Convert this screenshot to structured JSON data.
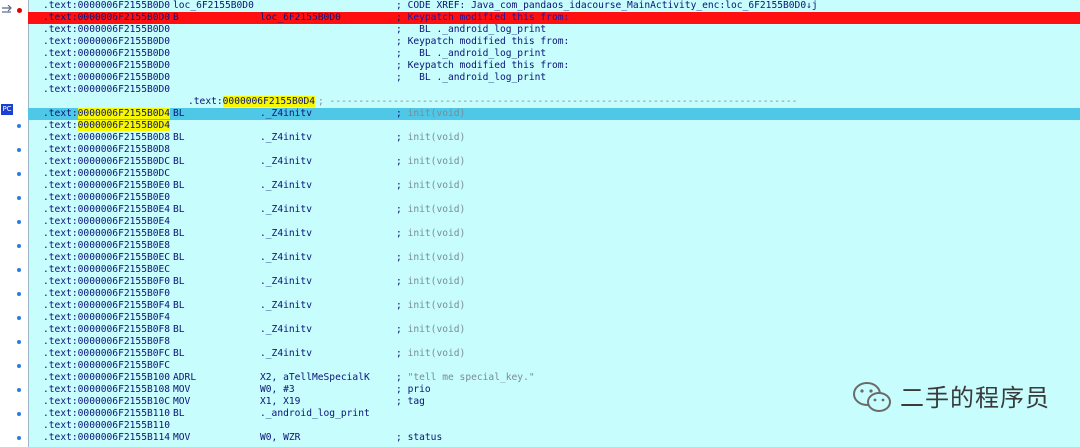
{
  "gutter": {
    "pc_label": "PC"
  },
  "rows": [
    {
      "addr": "text:0000006F2155B0D0",
      "addr_hl": "",
      "mnem": "loc_6F2155B0D0",
      "oper": "",
      "comment": "CODE XREF: Java_com_pandaos_idacourse_MainActivity_enc:loc_6F2155B0D0↓j",
      "style": ""
    },
    {
      "addr": "text:0000006F2155B0D0",
      "addr_hl": "",
      "mnem": "B",
      "oper": "loc_6F2155B0D0",
      "comment": "Keypatch modified this from:",
      "style": "hl-red"
    },
    {
      "addr": "text:0000006F2155B0D0",
      "addr_hl": "",
      "mnem": "",
      "oper": "",
      "comment": "  BL ._android_log_print",
      "style": ""
    },
    {
      "addr": "text:0000006F2155B0D0",
      "addr_hl": "",
      "mnem": "",
      "oper": "",
      "comment": "Keypatch modified this from:",
      "style": ""
    },
    {
      "addr": "text:0000006F2155B0D0",
      "addr_hl": "",
      "mnem": "",
      "oper": "",
      "comment": "  BL ._android_log_print",
      "style": ""
    },
    {
      "addr": "text:0000006F2155B0D0",
      "addr_hl": "",
      "mnem": "",
      "oper": "",
      "comment": "Keypatch modified this from:",
      "style": ""
    },
    {
      "addr": "text:0000006F2155B0D0",
      "addr_hl": "",
      "mnem": "",
      "oper": "",
      "comment": "  BL ._android_log_print",
      "style": ""
    },
    {
      "addr": "text:0000006F2155B0D0",
      "addr_hl": "",
      "mnem": "",
      "oper": "",
      "comment": "",
      "style": ""
    },
    {
      "addr": "text:",
      "addr_hl": "0000006F2155B0D4",
      "mnem": "",
      "oper": "",
      "comment": "",
      "style": "sep"
    },
    {
      "addr": "text:",
      "addr_hl": "0000006F2155B0D4",
      "mnem": "BL",
      "oper": "._Z4initv",
      "comment": "init(void)",
      "style": "hl-cur dim"
    },
    {
      "addr": "text:",
      "addr_hl": "0000006F2155B0D4",
      "mnem": "",
      "oper": "",
      "comment": "",
      "style": ""
    },
    {
      "addr": "text:0000006F2155B0D8",
      "addr_hl": "",
      "mnem": "BL",
      "oper": "._Z4initv",
      "comment": "init(void)",
      "style": "dim"
    },
    {
      "addr": "text:0000006F2155B0D8",
      "addr_hl": "",
      "mnem": "",
      "oper": "",
      "comment": "",
      "style": ""
    },
    {
      "addr": "text:0000006F2155B0DC",
      "addr_hl": "",
      "mnem": "BL",
      "oper": "._Z4initv",
      "comment": "init(void)",
      "style": "dim"
    },
    {
      "addr": "text:0000006F2155B0DC",
      "addr_hl": "",
      "mnem": "",
      "oper": "",
      "comment": "",
      "style": ""
    },
    {
      "addr": "text:0000006F2155B0E0",
      "addr_hl": "",
      "mnem": "BL",
      "oper": "._Z4initv",
      "comment": "init(void)",
      "style": "dim"
    },
    {
      "addr": "text:0000006F2155B0E0",
      "addr_hl": "",
      "mnem": "",
      "oper": "",
      "comment": "",
      "style": ""
    },
    {
      "addr": "text:0000006F2155B0E4",
      "addr_hl": "",
      "mnem": "BL",
      "oper": "._Z4initv",
      "comment": "init(void)",
      "style": "dim"
    },
    {
      "addr": "text:0000006F2155B0E4",
      "addr_hl": "",
      "mnem": "",
      "oper": "",
      "comment": "",
      "style": ""
    },
    {
      "addr": "text:0000006F2155B0E8",
      "addr_hl": "",
      "mnem": "BL",
      "oper": "._Z4initv",
      "comment": "init(void)",
      "style": "dim"
    },
    {
      "addr": "text:0000006F2155B0E8",
      "addr_hl": "",
      "mnem": "",
      "oper": "",
      "comment": "",
      "style": ""
    },
    {
      "addr": "text:0000006F2155B0EC",
      "addr_hl": "",
      "mnem": "BL",
      "oper": "._Z4initv",
      "comment": "init(void)",
      "style": "dim"
    },
    {
      "addr": "text:0000006F2155B0EC",
      "addr_hl": "",
      "mnem": "",
      "oper": "",
      "comment": "",
      "style": ""
    },
    {
      "addr": "text:0000006F2155B0F0",
      "addr_hl": "",
      "mnem": "BL",
      "oper": "._Z4initv",
      "comment": "init(void)",
      "style": "dim"
    },
    {
      "addr": "text:0000006F2155B0F0",
      "addr_hl": "",
      "mnem": "",
      "oper": "",
      "comment": "",
      "style": ""
    },
    {
      "addr": "text:0000006F2155B0F4",
      "addr_hl": "",
      "mnem": "BL",
      "oper": "._Z4initv",
      "comment": "init(void)",
      "style": "dim"
    },
    {
      "addr": "text:0000006F2155B0F4",
      "addr_hl": "",
      "mnem": "",
      "oper": "",
      "comment": "",
      "style": ""
    },
    {
      "addr": "text:0000006F2155B0F8",
      "addr_hl": "",
      "mnem": "BL",
      "oper": "._Z4initv",
      "comment": "init(void)",
      "style": "dim"
    },
    {
      "addr": "text:0000006F2155B0F8",
      "addr_hl": "",
      "mnem": "",
      "oper": "",
      "comment": "",
      "style": ""
    },
    {
      "addr": "text:0000006F2155B0FC",
      "addr_hl": "",
      "mnem": "BL",
      "oper": "._Z4initv",
      "comment": "init(void)",
      "style": "dim"
    },
    {
      "addr": "text:0000006F2155B0FC",
      "addr_hl": "",
      "mnem": "",
      "oper": "",
      "comment": "",
      "style": ""
    },
    {
      "addr": "text:0000006F2155B100",
      "addr_hl": "",
      "mnem": "ADRL",
      "oper": "X2, aTellMeSpecialK",
      "comment": "\"tell me special_key.\"",
      "style": "dim"
    },
    {
      "addr": "text:0000006F2155B108",
      "addr_hl": "",
      "mnem": "MOV",
      "oper": "W0, #3",
      "comment": "prio",
      "style": ""
    },
    {
      "addr": "text:0000006F2155B10C",
      "addr_hl": "",
      "mnem": "MOV",
      "oper": "X1, X19",
      "comment": "tag",
      "style": ""
    },
    {
      "addr": "text:0000006F2155B110",
      "addr_hl": "",
      "mnem": "BL",
      "oper": "._android_log_print",
      "comment": "",
      "style": ""
    },
    {
      "addr": "text:0000006F2155B110",
      "addr_hl": "",
      "mnem": "",
      "oper": "",
      "comment": "",
      "style": ""
    },
    {
      "addr": "text:0000006F2155B114",
      "addr_hl": "",
      "mnem": "MOV",
      "oper": "W0, WZR",
      "comment": "status",
      "style": ""
    }
  ],
  "separator": "; ---------------------------------------------------------------------------------",
  "watermark": {
    "text": "二手的程序员",
    "icon": "wechat-icon"
  },
  "colors": {
    "background": "#c7fdfd",
    "breakpoint_row": "#ff0f0f",
    "current_row": "#4ec8e6",
    "address_highlight": "#f7f700"
  }
}
